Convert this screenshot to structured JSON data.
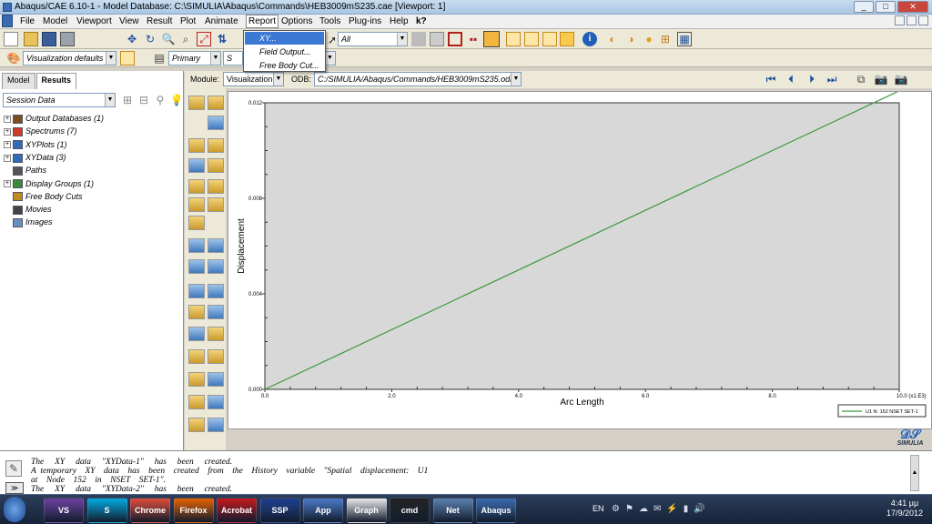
{
  "window": {
    "title": "Abaqus/CAE 6.10-1 - Model Database: C:\\SIMULIA\\Abaqus\\Commands\\HEB3009mS235.cae [Viewport: 1]",
    "controls": {
      "min": "_",
      "max": "□",
      "close": "✕"
    }
  },
  "menubar": {
    "items": [
      "File",
      "Model",
      "Viewport",
      "View",
      "Result",
      "Plot",
      "Animate",
      "Report",
      "Options",
      "Tools",
      "Plug-ins",
      "Help",
      "k?"
    ]
  },
  "report_menu": {
    "items": [
      "XY...",
      "Field Output...",
      "Free Body Cut..."
    ]
  },
  "toolbar": {
    "filter_select": "All",
    "render_style": "Visualization defaults",
    "primary_select": "Primary",
    "s_select": "S"
  },
  "module_row": {
    "module_label": "Module:",
    "module_value": "Visualization",
    "odb_label": "ODB:",
    "odb_value": "C:/SIMULIA/Abaqus/Commands/HEB3009mS235.odb"
  },
  "left_panel": {
    "tabs": [
      "Model",
      "Results"
    ],
    "session_select": "Session Data",
    "tree": [
      {
        "label": "Output Databases (1)",
        "expandable": true,
        "color": "#7d4d1f"
      },
      {
        "label": "Spectrums (7)",
        "expandable": true,
        "color": "#d23a2a"
      },
      {
        "label": "XYPlots (1)",
        "expandable": true,
        "color": "#2f6bb8"
      },
      {
        "label": "XYData (3)",
        "expandable": true,
        "color": "#2f6bb8"
      },
      {
        "label": "Paths",
        "expandable": false,
        "color": "#555555"
      },
      {
        "label": "Display Groups (1)",
        "expandable": true,
        "color": "#3a8a3a"
      },
      {
        "label": "Free Body Cuts",
        "expandable": false,
        "color": "#c08a20"
      },
      {
        "label": "Movies",
        "expandable": false,
        "color": "#444444"
      },
      {
        "label": "Images",
        "expandable": false,
        "color": "#6a8fbf"
      }
    ]
  },
  "chart_data": {
    "type": "line",
    "xlabel": "Arc Length",
    "ylabel": "Displacement",
    "xlim": [
      0,
      10
    ],
    "ylim": [
      0,
      0.012
    ],
    "x_ticks": [
      "0.0",
      "2.0",
      "4.0",
      "6.0",
      "8.0",
      "10.0 (x1.E3)"
    ],
    "y_ticks": [
      "0.000",
      "0.004",
      "0.008",
      "0.012"
    ],
    "series": [
      {
        "name": "U1 N: 152 NSET SET-1",
        "color": "#3a9a3a",
        "x": [
          0,
          10
        ],
        "y": [
          0,
          0.0125
        ]
      }
    ],
    "legend": "bottom-right",
    "plot_bg": "#d8d8d8"
  },
  "messages": [
    "The     XY     data     \"XYData-1\"     has     been     created.",
    "A  temporary    XY    data    has    been    created    from    the    History    variable    \"Spatial    displacement:    U1",
    "at    Node    152    in    NSET    SET-1\".",
    "The     XY     data     \"XYData-2\"     has     been     created."
  ],
  "logo": "SIMULIA",
  "taskbar": {
    "apps": [
      "VS",
      "S",
      "Chrome",
      "Firefox",
      "Acrobat",
      "SSP",
      "App",
      "Graph",
      "cmd",
      "Net",
      "Abaqus"
    ],
    "lang": "EN",
    "time": "4:41 μμ",
    "date": "17/9/2012"
  }
}
